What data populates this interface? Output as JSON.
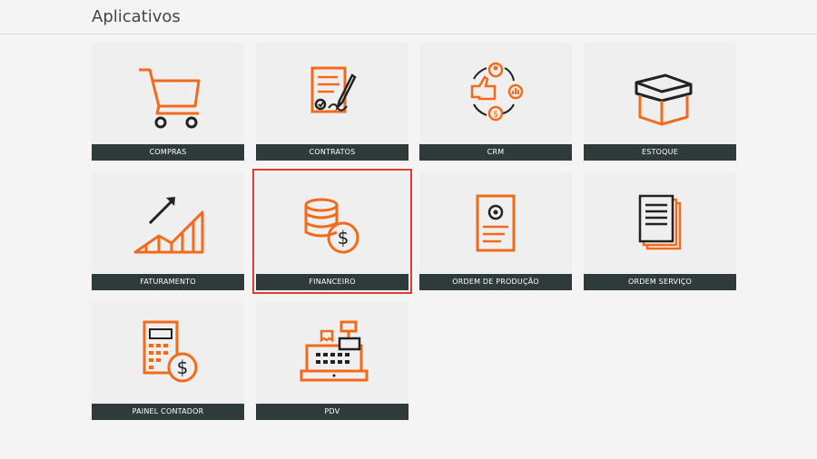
{
  "header": {
    "title": "Aplicativos"
  },
  "accent_color": "#f26b1d",
  "apps": [
    {
      "label": "COMPRAS",
      "icon": "shopping-cart-icon"
    },
    {
      "label": "CONTRATOS",
      "icon": "contract-signature-icon"
    },
    {
      "label": "CRM",
      "icon": "crm-cycle-icon"
    },
    {
      "label": "ESTOQUE",
      "icon": "box-icon"
    },
    {
      "label": "FATURAMENTO",
      "icon": "growth-chart-icon"
    },
    {
      "label": "FINANCEIRO",
      "icon": "coins-dollar-icon",
      "selected": true
    },
    {
      "label": "ORDEM DE PRODUÇÃO",
      "icon": "production-order-icon"
    },
    {
      "label": "ORDEM SERVIÇO",
      "icon": "documents-stack-icon"
    },
    {
      "label": "PAINEL CONTADOR",
      "icon": "calculator-dollar-icon"
    },
    {
      "label": "PDV",
      "icon": "cash-register-icon"
    }
  ]
}
